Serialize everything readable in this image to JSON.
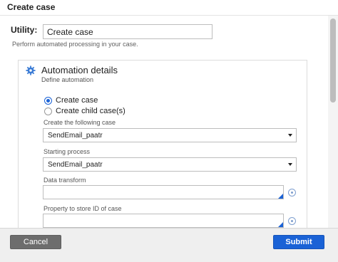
{
  "dialog": {
    "title": "Create case"
  },
  "utility": {
    "label": "Utility:",
    "value": "Create case",
    "help": "Perform automated processing in your case."
  },
  "panel": {
    "icon": "gear-icon",
    "title": "Automation details",
    "subtitle": "Define automation",
    "options": [
      {
        "label": "Create case",
        "checked": true
      },
      {
        "label": "Create child case(s)",
        "checked": false
      }
    ],
    "fields": {
      "case_type": {
        "label": "Create the following case",
        "value": "SendEmail_paatr"
      },
      "starting_process": {
        "label": "Starting process",
        "value": "SendEmail_paatr"
      },
      "data_transform": {
        "label": "Data transform",
        "value": ""
      },
      "property_store_id": {
        "label": "Property to store ID of case",
        "value": ""
      }
    }
  },
  "footer": {
    "cancel_label": "Cancel",
    "submit_label": "Submit"
  },
  "colors": {
    "accent": "#1a62d6",
    "cancel_bg": "#6d6d6d",
    "footer_bg": "#efefef"
  }
}
